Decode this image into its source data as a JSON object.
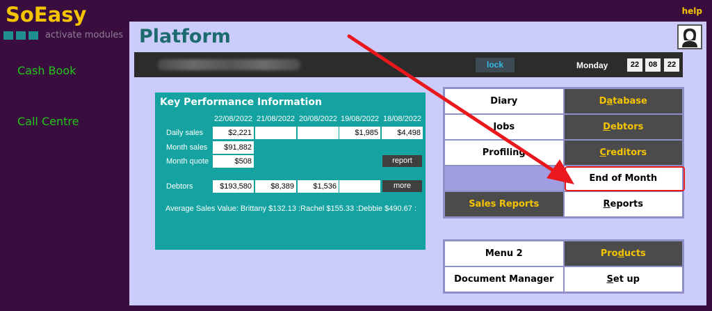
{
  "app": {
    "name": "SoEasy",
    "modules_label": "activate modules",
    "help_label": "help"
  },
  "sidebar": {
    "items": [
      "Cash Book",
      "Call Centre"
    ]
  },
  "page": {
    "title": "Platform"
  },
  "topbar": {
    "lock_label": "lock",
    "day": "Monday",
    "time": [
      "22",
      "08",
      "22"
    ]
  },
  "kpi": {
    "title": "Key Performance Information",
    "dates": [
      "22/08/2022",
      "21/08/2022",
      "20/08/2022",
      "19/08/2022",
      "18/08/2022"
    ],
    "rows": {
      "daily_sales": {
        "label": "Daily sales",
        "values": [
          "$2,221",
          "",
          "",
          "$1,985",
          "$4,498"
        ]
      },
      "month_sales": {
        "label": "Month sales",
        "value": "$91,882"
      },
      "month_quote": {
        "label": "Month quote",
        "value": "$508"
      },
      "debtors": {
        "label": "Debtors",
        "values": [
          "$193,580",
          "$8,389",
          "$1,536",
          ""
        ]
      }
    },
    "report_label": "report",
    "more_label": "more",
    "average": "Average Sales Value: Brittany $132.13 :Rachel $155.33 :Debbie $490.67 :"
  },
  "menu": {
    "diary": "Diary",
    "database": "Database",
    "jobs": "Jobs",
    "debtors": "Debtors",
    "profiling": "Profiling",
    "creditors": "Creditors",
    "end_of_month": "End of Month",
    "sales_reports": "Sales Reports",
    "reports": "Reports",
    "menu2": "Menu 2",
    "products": "Products",
    "document_manager": "Document Manager",
    "setup": "Set up"
  },
  "colors": {
    "accent": "#f5c400",
    "panel": "#ccccfa",
    "kpi": "#14a3a1",
    "highlight": "#e8181c"
  }
}
